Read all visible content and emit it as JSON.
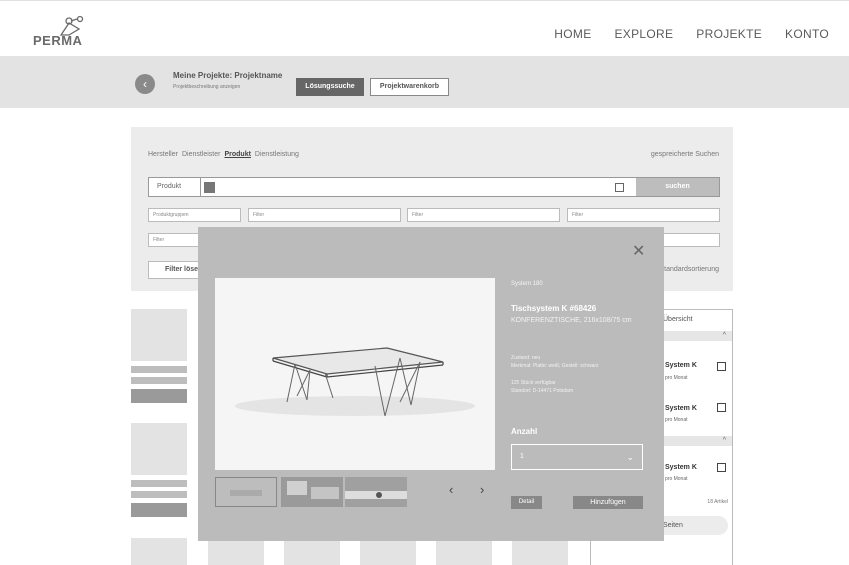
{
  "brand": {
    "name": "PERMA"
  },
  "nav": {
    "items": [
      "HOME",
      "EXPLORE",
      "PROJEKTE",
      "KONTO"
    ]
  },
  "project": {
    "title": "Meine Projekte: Projektname",
    "subtitle": "Projektbeschreibung anzeigen",
    "btn_loesung": "Lösungssuche",
    "btn_warenkorb": "Projektwarenkorb"
  },
  "search": {
    "tabs": [
      "Hersteller",
      "Dienstleister",
      "Produkt",
      "Dienstleistung"
    ],
    "active_tab": "Produkt",
    "saved": "gespreicherte Suchen",
    "field_label": "Produkt",
    "submit": "suchen",
    "filters": [
      "Produktgruppen",
      "Filter",
      "Filter",
      "Filter",
      "Filter"
    ],
    "clear": "Filter lösen",
    "sort": "Standardsortierung"
  },
  "side": {
    "header": "Übersicht",
    "items": [
      {
        "title": "System K",
        "price": "pro Monat"
      },
      {
        "title": "System K",
        "price": "pro Monat"
      },
      {
        "title": "System K",
        "price": "pro Monat"
      }
    ],
    "count": "18 Artikel",
    "more": "Seiten"
  },
  "modal": {
    "series": "System 180",
    "name": "Tischsystem K #68426",
    "category": "KONFERENZTISCHE, 216x108/75 cm",
    "condition": "Zustand: neu",
    "material": "Merkmal: Platte: weiß; Gestell: schwarz",
    "stock": "125 Stück verfügbar",
    "location": "Standort: D-14471 Potsdam",
    "qty_label": "Anzahl",
    "qty_value": "1",
    "btn_detail": "Detail",
    "btn_add": "Hinzufügen"
  }
}
